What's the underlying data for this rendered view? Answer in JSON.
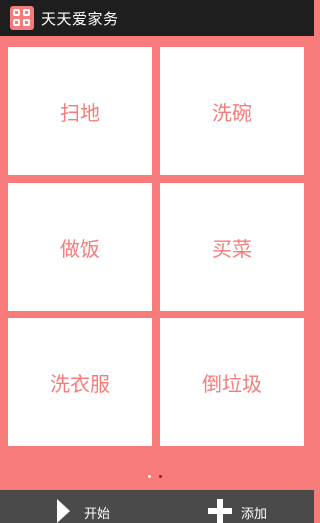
{
  "app": {
    "title": "天天爱家务",
    "icon": "app-grid-icon"
  },
  "colors": {
    "accent": "#f77b7b",
    "titlebar": "#1e1e1e",
    "bottombar": "#4a4a4a",
    "tile": "#ffffff"
  },
  "chores": [
    {
      "label": "扫地"
    },
    {
      "label": "洗碗"
    },
    {
      "label": "做饭"
    },
    {
      "label": "买菜"
    },
    {
      "label": "洗衣服"
    },
    {
      "label": "倒垃圾"
    }
  ],
  "pager": {
    "pages": 2,
    "current": 1
  },
  "toolbar": {
    "start_label": "开始",
    "start_icon": "play-icon",
    "add_label": "添加",
    "add_icon": "plus-icon"
  }
}
